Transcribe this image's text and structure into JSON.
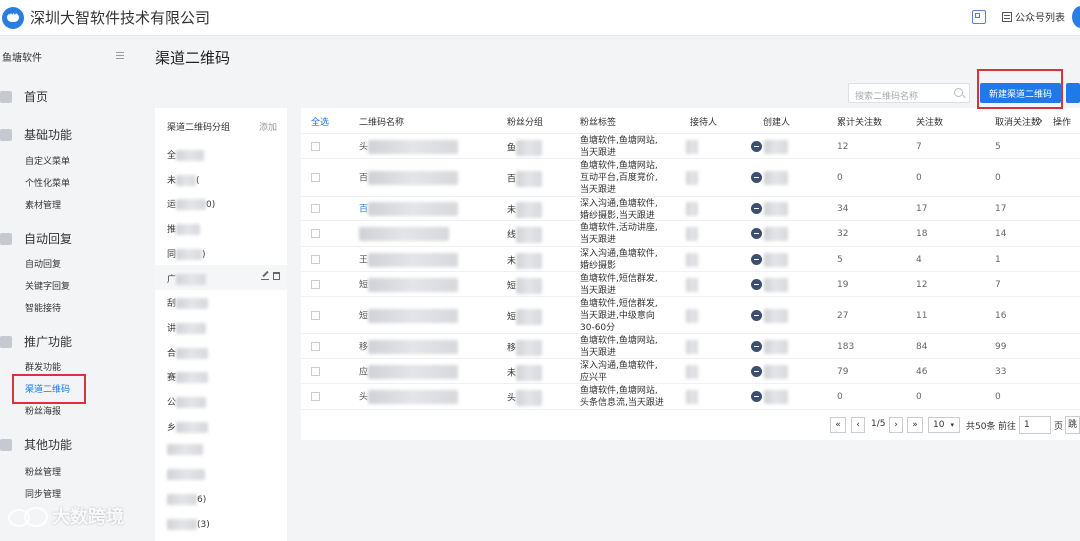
{
  "topbar": {
    "company": "深圳大智软件技术有限公司",
    "account_list_label": "公众号列表"
  },
  "sidebar": {
    "title": "鱼塘软件",
    "groups": [
      {
        "label": "首页",
        "icon": "home-icon",
        "items": []
      },
      {
        "label": "基础功能",
        "icon": "grid-icon",
        "items": [
          "自定义菜单",
          "个性化菜单",
          "素材管理"
        ]
      },
      {
        "label": "自动回复",
        "icon": "chat-icon",
        "items": [
          "自动回复",
          "关键字回复",
          "智能接待"
        ]
      },
      {
        "label": "推广功能",
        "icon": "megaphone-icon",
        "items": [
          "群发功能",
          "渠道二维码",
          "粉丝海报"
        ]
      },
      {
        "label": "其他功能",
        "icon": "more-icon",
        "items": [
          "粉丝管理",
          "同步管理"
        ]
      }
    ],
    "active_item": "渠道二维码"
  },
  "page": {
    "title": "渠道二维码"
  },
  "group_panel": {
    "title": "渠道二维码分组",
    "add_label": "添加",
    "items": [
      {
        "prefix": "全",
        "suffix": ""
      },
      {
        "prefix": "未",
        "suffix": "("
      },
      {
        "prefix": "运",
        "suffix": "0)"
      },
      {
        "prefix": "推",
        "suffix": ""
      },
      {
        "prefix": "同",
        "suffix": ")"
      },
      {
        "prefix": "广",
        "suffix": ""
      },
      {
        "prefix": "刮",
        "suffix": ""
      },
      {
        "prefix": "讲",
        "suffix": ""
      },
      {
        "prefix": "合",
        "suffix": ""
      },
      {
        "prefix": "赛",
        "suffix": ""
      },
      {
        "prefix": "公",
        "suffix": ""
      },
      {
        "prefix": "乡",
        "suffix": ""
      },
      {
        "prefix": "",
        "suffix": ""
      },
      {
        "prefix": "",
        "suffix": ""
      },
      {
        "prefix": "",
        "suffix": "6)"
      },
      {
        "prefix": "",
        "suffix": "(3)"
      }
    ]
  },
  "toolbar": {
    "search_placeholder": "搜索二维码名称",
    "new_button": "新建渠道二维码"
  },
  "table": {
    "headers": [
      "全选",
      "二维码名称",
      "粉丝分组",
      "粉丝标签",
      "接待人",
      "创建人",
      "累计关注数",
      "关注数",
      "取消关注数",
      "操作"
    ],
    "rows": [
      {
        "name": "头",
        "group": "鱼",
        "tags": [
          "鱼塘软件,鱼塘网站,",
          "当天跟进"
        ],
        "creator": "",
        "total": "12",
        "follow": "7",
        "unfollow": "5"
      },
      {
        "name": "百",
        "group": "百",
        "tags": [
          "鱼塘软件,鱼塘网站,",
          "互动平台,百度竞价,",
          "当天跟进"
        ],
        "creator": "",
        "total": "0",
        "follow": "0",
        "unfollow": "0"
      },
      {
        "name": "百",
        "group": "未",
        "tags": [
          "深入沟通,鱼塘软件,",
          "婚纱摄影,当天跟进"
        ],
        "creator": "",
        "total": "34",
        "follow": "17",
        "unfollow": "17"
      },
      {
        "name": "",
        "group": "线",
        "tags": [
          "鱼塘软件,活动讲座,",
          "当天跟进"
        ],
        "creator": "",
        "total": "32",
        "follow": "18",
        "unfollow": "14"
      },
      {
        "name": "王",
        "group": "未",
        "tags": [
          "深入沟通,鱼塘软件,",
          "婚纱摄影"
        ],
        "creator": "",
        "total": "5",
        "follow": "4",
        "unfollow": "1"
      },
      {
        "name": "短",
        "group": "短",
        "tags": [
          "鱼塘软件,短信群发,",
          "当天跟进"
        ],
        "creator": "",
        "total": "19",
        "follow": "12",
        "unfollow": "7"
      },
      {
        "name": "短",
        "group": "短",
        "tags": [
          "鱼塘软件,短信群发,",
          "当天跟进,中级意向",
          "30-60分"
        ],
        "creator": "",
        "total": "27",
        "follow": "11",
        "unfollow": "16"
      },
      {
        "name": "移",
        "group": "移",
        "tags": [
          "鱼塘软件,鱼塘网站,",
          "当天跟进"
        ],
        "creator": "",
        "total": "183",
        "follow": "84",
        "unfollow": "99"
      },
      {
        "name": "应",
        "group": "未",
        "tags": [
          "深入沟通,鱼塘软件,",
          "应兴平"
        ],
        "creator": "",
        "total": "79",
        "follow": "46",
        "unfollow": "33"
      },
      {
        "name": "头",
        "group": "头",
        "tags": [
          "鱼塘软件,鱼塘网站,",
          "头条信息流,当天跟进"
        ],
        "creator": "",
        "total": "0",
        "follow": "0",
        "unfollow": "0"
      }
    ]
  },
  "pagination": {
    "first": "«",
    "prev": "‹",
    "page_info": "1/5",
    "next": "›",
    "last": "»",
    "page_size": "10",
    "total_text": "共50条",
    "goto_label": "前往",
    "goto_value": "1",
    "page_unit": "页",
    "go_label": "跳"
  },
  "watermark": "大数跨境"
}
